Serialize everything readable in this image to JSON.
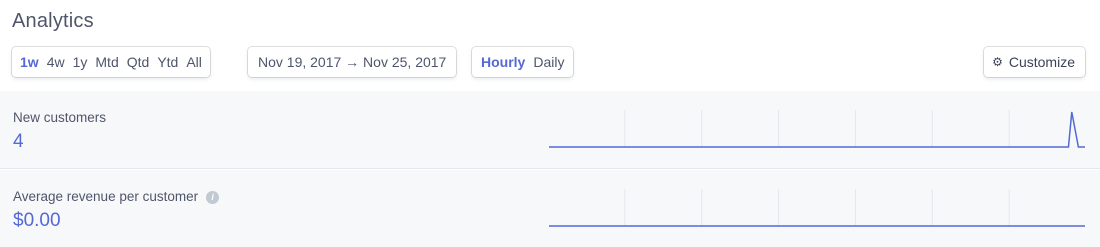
{
  "page": {
    "title": "Analytics"
  },
  "range_buttons": [
    "1w",
    "4w",
    "1y",
    "Mtd",
    "Qtd",
    "Ytd",
    "All"
  ],
  "range_active": "1w",
  "date_range": "Nov 19, 2017 → Nov 25, 2017",
  "granularity": {
    "options": [
      "Hourly",
      "Daily"
    ],
    "active": "Hourly"
  },
  "customize": {
    "label": "Customize",
    "icon": "gear-icon"
  },
  "metrics": {
    "new_customers": {
      "label": "New customers",
      "value": "4"
    },
    "avg_revenue": {
      "label": "Average revenue per customer",
      "value": "$0.00",
      "info_icon": "info-icon"
    }
  },
  "colors": {
    "accent": "#5469d4",
    "panel_bg": "#f7f8fa",
    "grid": "#e3e8ee"
  },
  "sparklines": {
    "new_customers": {
      "points": [
        0,
        0,
        0,
        0,
        0,
        0,
        0,
        0,
        0,
        0,
        0,
        0,
        0,
        0,
        0,
        0,
        0,
        0,
        0,
        0,
        0,
        0,
        0,
        0,
        0,
        0,
        0,
        0,
        0,
        0,
        0,
        0,
        0,
        0,
        0,
        0,
        0,
        0,
        0,
        0,
        0,
        0,
        0,
        0,
        0,
        0,
        0,
        0,
        0,
        0,
        0,
        0,
        0,
        0,
        0,
        0,
        0,
        0,
        0,
        0,
        0,
        0,
        0,
        0,
        0,
        0,
        0,
        0,
        0,
        0,
        0,
        0,
        0,
        0,
        0,
        0,
        0,
        0,
        0,
        0,
        0,
        0,
        0,
        0,
        0,
        0,
        0,
        0,
        0,
        0,
        0,
        0,
        0,
        0,
        0,
        0,
        0,
        0,
        0,
        0,
        0,
        0,
        0,
        0,
        0,
        0,
        0,
        0,
        0,
        0,
        0,
        0,
        0,
        0,
        0,
        0,
        0,
        0,
        0,
        0,
        0,
        0,
        0,
        0,
        0,
        0,
        0,
        0,
        0,
        0,
        0,
        0,
        0,
        0,
        0,
        0,
        0,
        0,
        0,
        0,
        0,
        0,
        0,
        0,
        0,
        0,
        0,
        0,
        0,
        0,
        0,
        0,
        0,
        0,
        0,
        0,
        0,
        0,
        2,
        1,
        0,
        0,
        0
      ]
    },
    "avg_revenue": {
      "points": [
        0,
        0,
        0,
        0,
        0,
        0,
        0,
        0,
        0,
        0,
        0,
        0,
        0,
        0,
        0,
        0,
        0,
        0,
        0,
        0,
        0,
        0,
        0,
        0,
        0,
        0,
        0,
        0,
        0,
        0,
        0,
        0,
        0,
        0,
        0,
        0,
        0,
        0,
        0,
        0,
        0,
        0,
        0,
        0,
        0,
        0,
        0,
        0,
        0,
        0,
        0,
        0,
        0,
        0,
        0,
        0,
        0,
        0,
        0,
        0,
        0,
        0,
        0,
        0,
        0,
        0,
        0,
        0,
        0,
        0,
        0,
        0,
        0,
        0,
        0,
        0,
        0,
        0,
        0,
        0,
        0,
        0,
        0,
        0,
        0,
        0,
        0,
        0,
        0,
        0,
        0,
        0,
        0,
        0,
        0,
        0,
        0,
        0,
        0,
        0,
        0,
        0,
        0,
        0,
        0,
        0,
        0,
        0,
        0,
        0,
        0,
        0,
        0,
        0,
        0,
        0,
        0,
        0,
        0,
        0,
        0,
        0,
        0,
        0,
        0,
        0,
        0,
        0,
        0,
        0,
        0,
        0,
        0,
        0,
        0,
        0,
        0,
        0,
        0,
        0,
        0,
        0,
        0,
        0,
        0,
        0,
        0,
        0,
        0,
        0,
        0,
        0,
        0,
        0,
        0,
        0,
        0,
        0,
        0,
        0,
        0,
        0,
        0
      ]
    }
  }
}
